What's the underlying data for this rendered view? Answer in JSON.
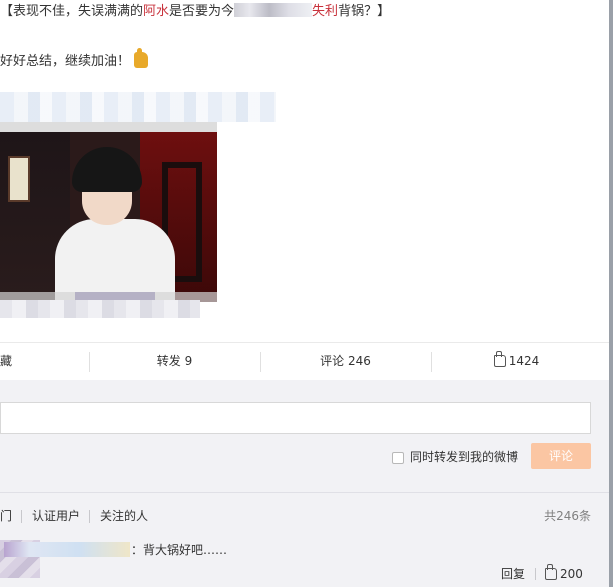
{
  "post": {
    "headline_prefix": "【表现不佳，失误满满的",
    "headline_name": "阿水",
    "headline_mid": "是否要为今",
    "headline_emphasis": "失利",
    "headline_suffix": "背锅？】",
    "body_text": "好好总结，继续加油！",
    "emoji": "thumbs-up-emoji"
  },
  "actions": {
    "collect": "藏",
    "repost": "转发 9",
    "comment": "评论 246",
    "like": "1424"
  },
  "comment_box": {
    "input_value": "",
    "repost_label": "同时转发到我的微博",
    "submit_label": "评论"
  },
  "filters": {
    "hot": "门",
    "verified": "认证用户",
    "following": "关注的人",
    "count": "共246条"
  },
  "comment": {
    "text": "：背大锅好吧……",
    "reply": "回复",
    "likes": "200"
  },
  "colors": {
    "highlight": "#c8323c",
    "submit_button": "#fbc6a3",
    "panel_bg": "#f2f2f5"
  }
}
